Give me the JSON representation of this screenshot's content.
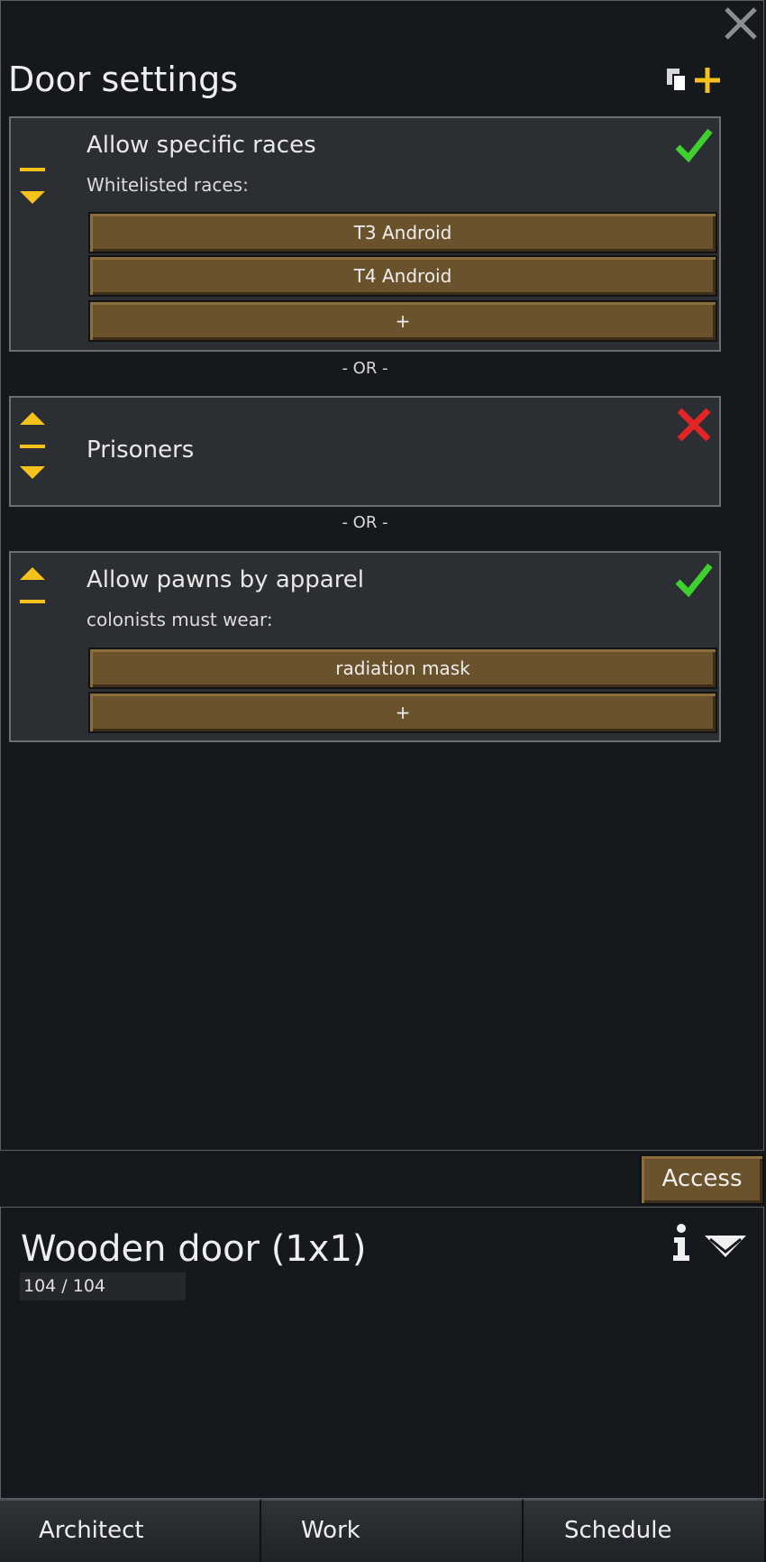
{
  "window": {
    "title": "Door settings",
    "close_icon": "close-icon",
    "copy_icon": "copy-icon",
    "add_icon": "plus-icon"
  },
  "cards": [
    {
      "title": "Allow specific races",
      "subtitle": "Whitelisted races:",
      "status": "enabled",
      "items": [
        "T3 Android",
        "T4 Android"
      ],
      "add_label": "+"
    },
    {
      "title": "Prisoners",
      "status": "disabled"
    },
    {
      "title": "Allow pawns by apparel",
      "subtitle": "colonists must wear:",
      "status": "enabled",
      "items": [
        "radiation mask"
      ],
      "add_label": "+"
    }
  ],
  "separator": "- OR -",
  "access_tab": "Access",
  "inspect": {
    "name": "Wooden door (1x1)",
    "hp": "104 / 104"
  },
  "bottom_tabs": [
    "Architect",
    "Work",
    "Schedule"
  ],
  "colors": {
    "check": "#3fcf2f",
    "cross": "#e22424",
    "accent": "#f4c21b",
    "wood": "#6a532c"
  }
}
